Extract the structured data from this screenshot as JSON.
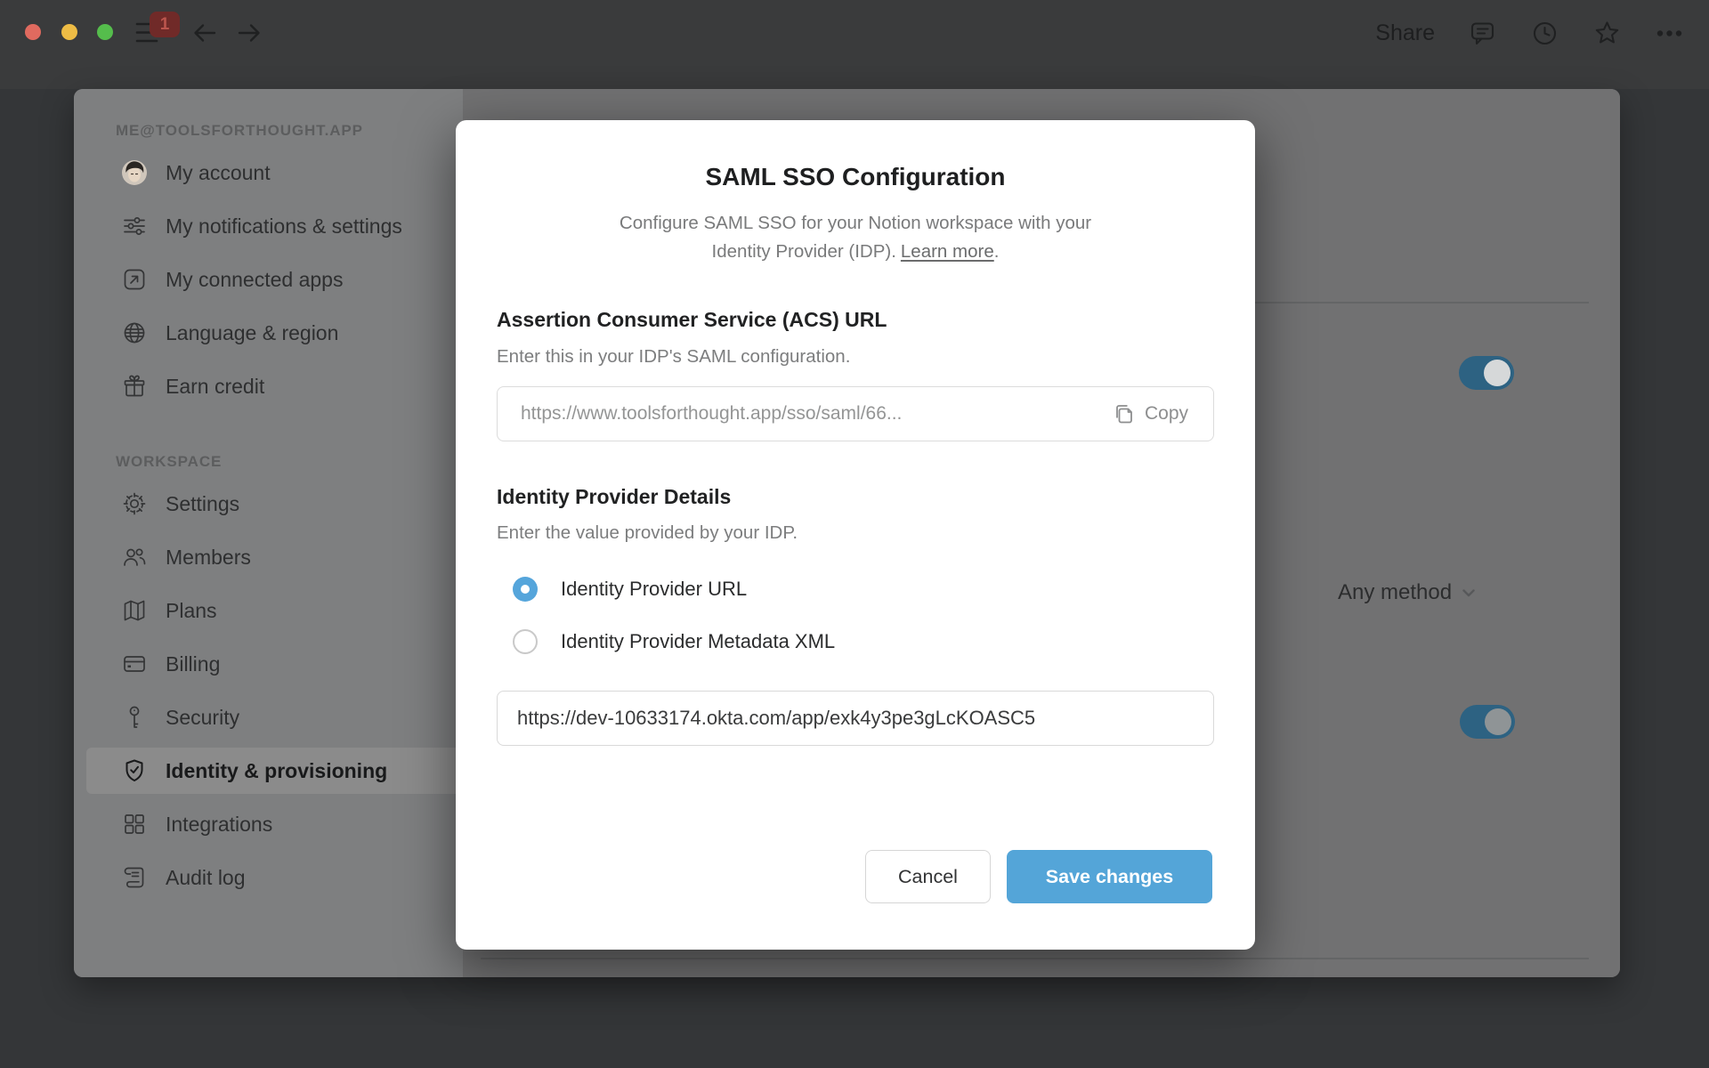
{
  "topbar": {
    "share_label": "Share",
    "badge_count": "1"
  },
  "sidebar": {
    "account_header": "ME@TOOLSFORTHOUGHT.APP",
    "items_account": [
      {
        "label": "My account"
      },
      {
        "label": "My notifications & settings"
      },
      {
        "label": "My connected apps"
      },
      {
        "label": "Language & region"
      },
      {
        "label": "Earn credit"
      }
    ],
    "workspace_header": "WORKSPACE",
    "items_workspace": [
      {
        "label": "Settings"
      },
      {
        "label": "Members"
      },
      {
        "label": "Plans"
      },
      {
        "label": "Billing"
      },
      {
        "label": "Security"
      },
      {
        "label": "Identity & provisioning",
        "selected": true
      },
      {
        "label": "Integrations"
      },
      {
        "label": "Audit log"
      }
    ]
  },
  "page": {
    "dropdown_value": "Any method",
    "toggle_1": "on",
    "toggle_2": "on"
  },
  "modal": {
    "title": "SAML SSO Configuration",
    "description": "Configure SAML SSO for your Notion workspace with your Identity Provider (IDP).",
    "learn_more_label": "Learn more",
    "learn_more_suffix": ".",
    "acs": {
      "heading": "Assertion Consumer Service (ACS) URL",
      "subtext": "Enter this in your IDP's SAML configuration.",
      "value": "https://www.toolsforthought.app/sso/saml/66...",
      "copy_label": "Copy"
    },
    "idp": {
      "heading": "Identity Provider Details",
      "subtext": "Enter the value provided by your IDP.",
      "option_url": "Identity Provider URL",
      "option_xml": "Identity Provider Metadata XML",
      "url_value": "https://dev-10633174.okta.com/app/exk4y3pe3gLcKOASC5"
    },
    "cancel_label": "Cancel",
    "save_label": "Save changes"
  },
  "colors": {
    "accent_blue": "#55a5db",
    "save_button_blue": "#54a5d8",
    "toggle_teal": "#2d6282",
    "badge_red": "#702a28"
  }
}
